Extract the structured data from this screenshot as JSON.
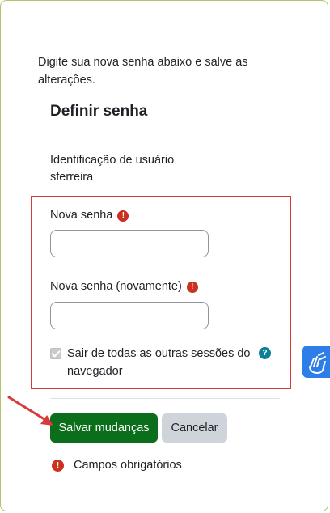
{
  "intro_text": "Digite sua nova senha abaixo e salve as alterações.",
  "section_title": "Definir senha",
  "user_id": {
    "label": "Identificação de usuário",
    "value": "sferreira"
  },
  "fields": {
    "new_password": {
      "label": "Nova senha",
      "value": ""
    },
    "new_password_again": {
      "label": "Nova senha (novamente)",
      "value": ""
    }
  },
  "logout_other_sessions": {
    "label": "Sair de todas as outras sessões do navegador",
    "checked": true
  },
  "buttons": {
    "save": "Salvar mudanças",
    "cancel": "Cancelar"
  },
  "required_note": "Campos obrigatórios",
  "icons": {
    "required": "exclamation-circle-icon",
    "help": "question-circle-icon",
    "accessibility": "sign-language-icon"
  },
  "colors": {
    "primary_button": "#0b6e1a",
    "highlight_border": "#d63a3a",
    "required_icon": "#ca3120",
    "help_icon": "#0f7e98",
    "accessibility_widget": "#2d7ee8"
  }
}
